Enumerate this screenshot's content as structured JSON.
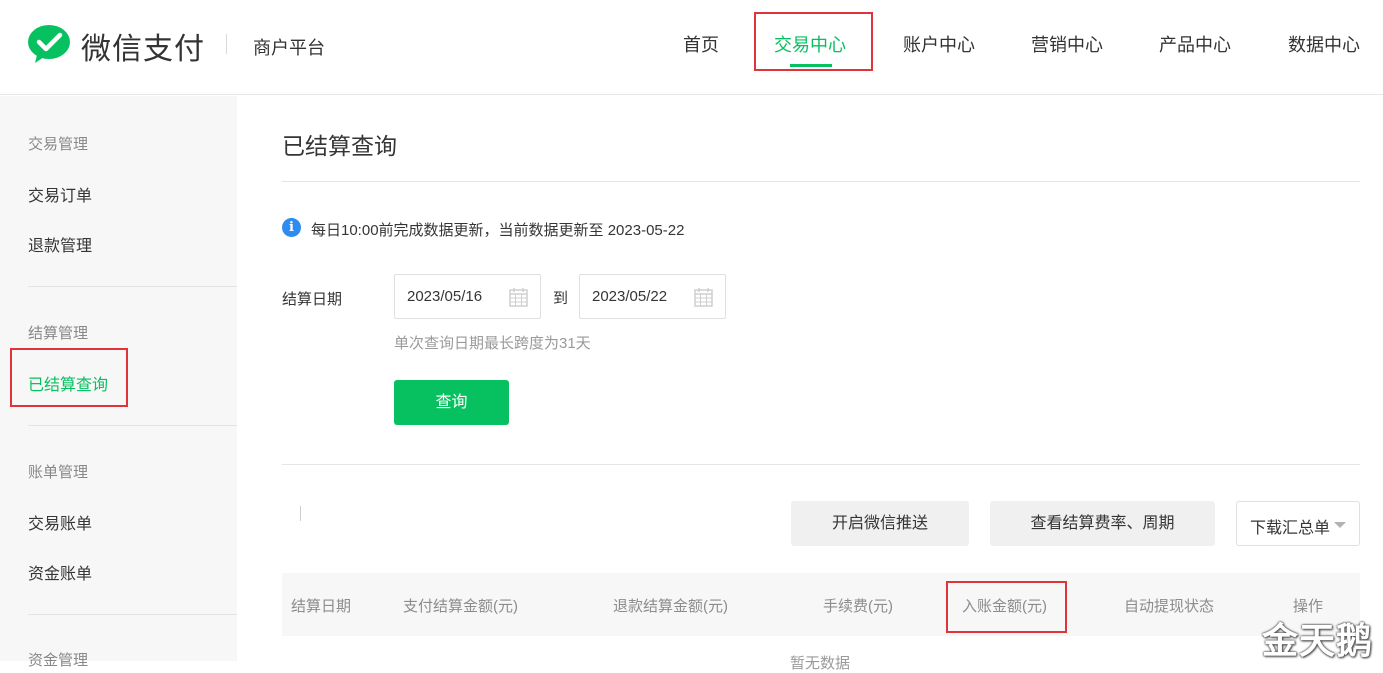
{
  "header": {
    "brand": "微信支付",
    "platform": "商户平台",
    "nav": [
      "首页",
      "交易中心",
      "账户中心",
      "营销中心",
      "产品中心",
      "数据中心"
    ]
  },
  "sidebar": {
    "groups": [
      {
        "title": "交易管理",
        "items": [
          "交易订单",
          "退款管理"
        ]
      },
      {
        "title": "结算管理",
        "items": [
          "已结算查询"
        ]
      },
      {
        "title": "账单管理",
        "items": [
          "交易账单",
          "资金账单"
        ]
      },
      {
        "title": "资金管理",
        "items": []
      }
    ]
  },
  "main": {
    "title": "已结算查询",
    "info": "每日10:00前完成数据更新，当前数据更新至 2023-05-22",
    "date_label": "结算日期",
    "date_start": "2023/05/16",
    "date_to": "到",
    "date_end": "2023/05/22",
    "hint": "单次查询日期最长跨度为31天",
    "query_button": "查询",
    "actions": {
      "push": "开启微信推送",
      "rate": "查看结算费率、周期",
      "download": "下载汇总单"
    },
    "table": {
      "headers": [
        "结算日期",
        "支付结算金额(元)",
        "退款结算金额(元)",
        "手续费(元)",
        "入账金额(元)",
        "自动提现状态",
        "操作"
      ],
      "empty": "暂无数据"
    }
  },
  "watermark": "金天鹅",
  "colors": {
    "accent": "#07c160",
    "highlight": "#e0343a",
    "info": "#2d8cf0"
  }
}
